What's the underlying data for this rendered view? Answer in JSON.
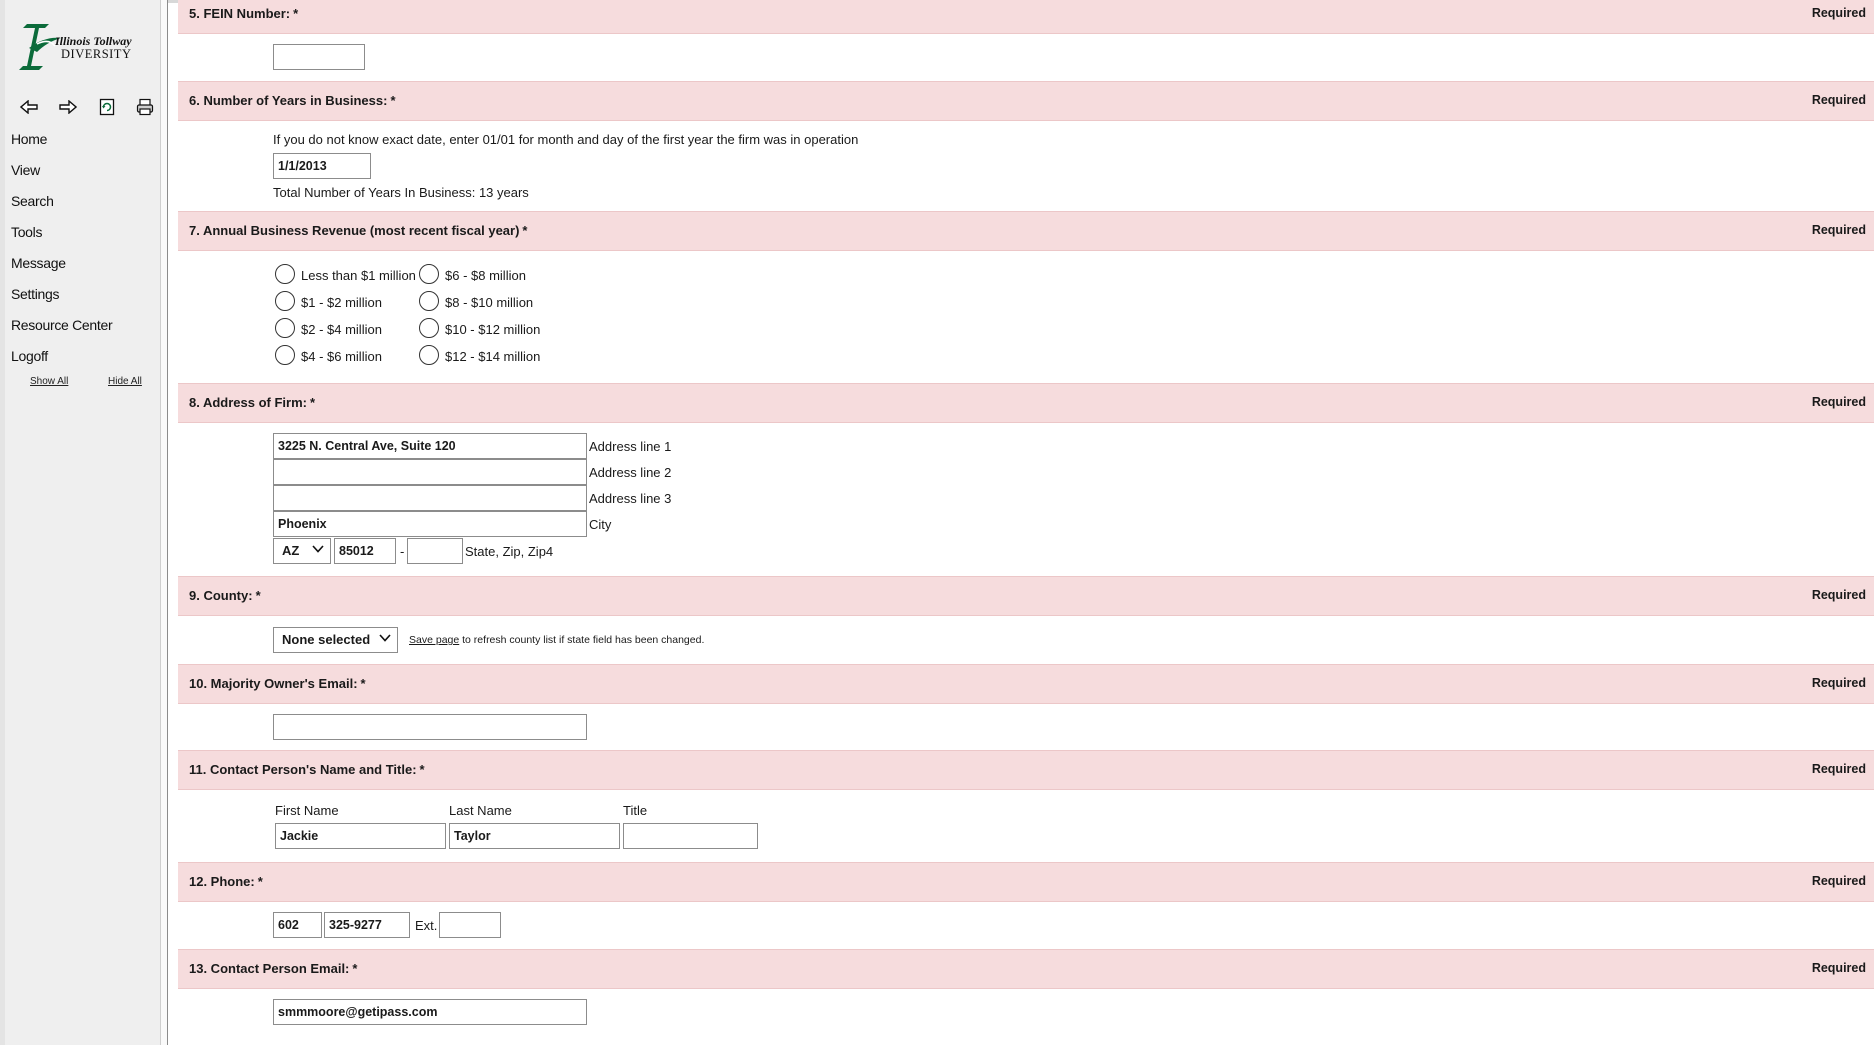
{
  "sidebar": {
    "logo": {
      "line1": "IllinoisTollway",
      "line2": "DIVERSITY"
    },
    "toolbar": [
      {
        "name": "back-arrow-icon"
      },
      {
        "name": "forward-arrow-icon"
      },
      {
        "name": "refresh-icon"
      },
      {
        "name": "print-icon"
      }
    ],
    "nav": [
      "Home",
      "View",
      "Search",
      "Tools",
      "Message",
      "Settings",
      "Resource Center",
      "Logoff"
    ],
    "show_all": "Show All",
    "hide_all": "Hide All"
  },
  "required_label": "Required",
  "sections": {
    "s5": {
      "title": "5. FEIN Number:",
      "star": "*",
      "value": ""
    },
    "s6": {
      "title": "6. Number of Years in Business:",
      "star": "*",
      "hint": "If you do not know exact date, enter 01/01 for month and day of the first year the firm was in operation",
      "value": "1/1/2013",
      "total": "Total Number of Years In Business: 13 years"
    },
    "s7": {
      "title": "7. Annual Business Revenue (most recent fiscal year)",
      "star": "*",
      "options": [
        "Less than $1 million",
        "$1 - $2 million",
        "$2 - $4 million",
        "$4 - $6 million",
        "$6 - $8 million",
        "$8 - $10 million",
        "$10 - $12 million",
        "$12 - $14 million"
      ],
      "selected": null
    },
    "s8": {
      "title": "8. Address of Firm:",
      "star": "*",
      "line1": "3225 N. Central Ave, Suite 120",
      "line1_label": "Address line 1",
      "line2": "",
      "line2_label": "Address line 2",
      "line3": "",
      "line3_label": "Address line 3",
      "city": "Phoenix",
      "city_label": "City",
      "state": "AZ",
      "zip": "85012",
      "zip_dash": "-",
      "zip4": "",
      "state_zip_label": "State, Zip, Zip4"
    },
    "s9": {
      "title": "9. County:",
      "star": "*",
      "county": "None selected",
      "save_link": "Save page",
      "note": " to refresh county list if state field has been changed."
    },
    "s10": {
      "title": "10. Majority Owner's Email:",
      "star": "*",
      "value": ""
    },
    "s11": {
      "title": "11. Contact Person's Name and Title:",
      "star": "*",
      "first_label": "First Name",
      "last_label": "Last Name",
      "title_label": "Title",
      "first": "Jackie",
      "last": "Taylor",
      "title_value": ""
    },
    "s12": {
      "title": "12. Phone:",
      "star": "*",
      "area": "602",
      "number": "325-9277",
      "ext_label": "Ext.",
      "ext": ""
    },
    "s13": {
      "title": "13. Contact Person Email:",
      "star": "*",
      "value": "smmmoore@getipass.com"
    }
  }
}
